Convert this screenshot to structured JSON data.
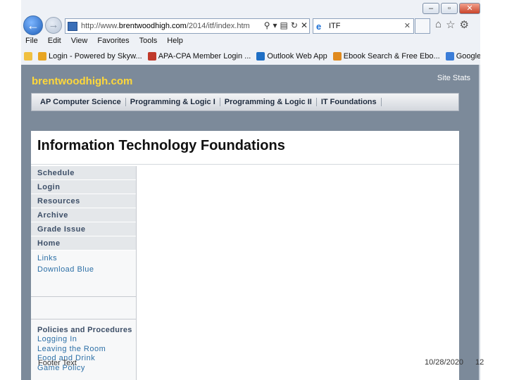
{
  "browser": {
    "url_prefix": "http://www.",
    "url_domain": "brentwoodhigh.com",
    "url_path": "/2014/itf/index.htm",
    "tab_title": "ITF",
    "menu": [
      "File",
      "Edit",
      "View",
      "Favorites",
      "Tools",
      "Help"
    ],
    "favorites": [
      {
        "label": "Login - Powered by Skyw...",
        "color": "#e8a521"
      },
      {
        "label": "APA-CPA Member Login ...",
        "color": "#c0392b"
      },
      {
        "label": "Outlook Web App",
        "color": "#1f6fc5"
      },
      {
        "label": "Ebook Search & Free Ebo...",
        "color": "#e08a1e"
      },
      {
        "label": "Google",
        "color": "#3b7dd8"
      }
    ]
  },
  "site": {
    "name": "brentwoodhigh.com",
    "stats": "Site Stats",
    "courses": [
      "AP Computer Science",
      "Programming & Logic I",
      "Programming & Logic II",
      "IT Foundations"
    ],
    "page_title": "Information Technology Foundations",
    "sidebar": [
      "Schedule",
      "Login",
      "Resources",
      "Archive",
      "Grade Issue",
      "Home"
    ],
    "links": [
      "Links",
      "Download Blue"
    ],
    "policies_heading": "Policies and Procedures",
    "policies": [
      "Logging In",
      "Leaving the Room",
      "Food and Drink",
      "Game Policy"
    ]
  },
  "slide": {
    "footer": "Footer Text",
    "date": "10/28/2020",
    "page": "12"
  }
}
